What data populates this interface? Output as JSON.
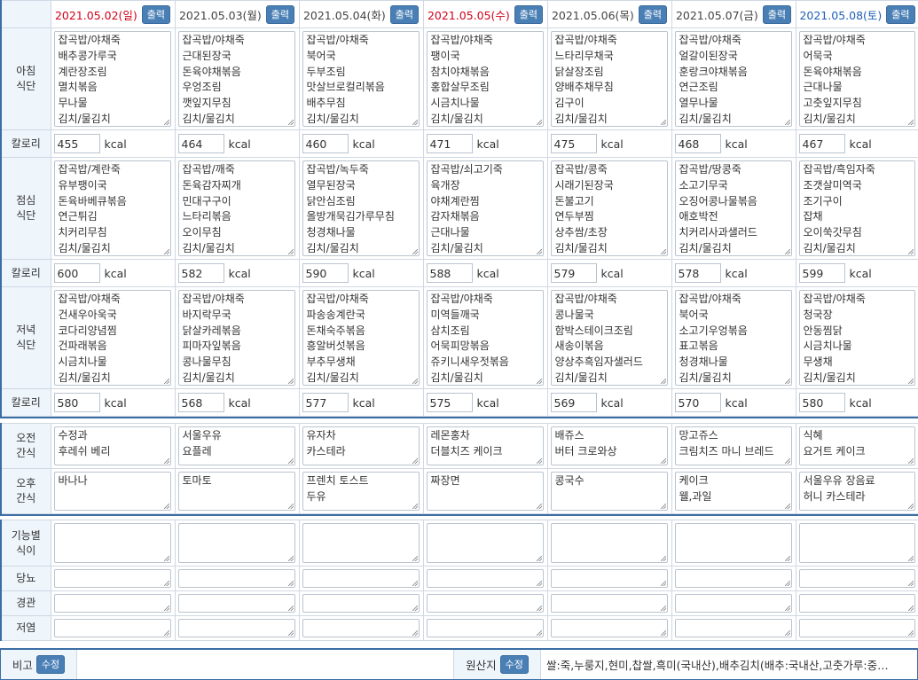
{
  "print_label": "출력",
  "edit_label": "수정",
  "unit": "kcal",
  "labels": {
    "breakfast": "아침\n식단",
    "lunch": "점심\n식단",
    "dinner": "저녁\n식단",
    "calorie": "칼로리",
    "am_snack": "오전\n간식",
    "pm_snack": "오후\n간식",
    "functional": "기능별\n식이",
    "diabetes": "당뇨",
    "tube": "경관",
    "low_salt": "저염"
  },
  "days": [
    {
      "date": "2021.05.02(일)",
      "type": "sun",
      "breakfast": "잡곡밥/야채죽\n배추콩가루국\n계란장조림\n멸치볶음\n무나물\n김치/물김치",
      "breakfast_kcal": "455",
      "lunch": "잡곡밥/계란죽\n유부팽이국\n돈육바베큐볶음\n연근튀김\n치커리무침\n김치/물김치",
      "lunch_kcal": "600",
      "dinner": "잡곡밥/야채죽\n건새우아욱국\n코다리양념찜\n건파래볶음\n시금치나물\n김치/물김치",
      "dinner_kcal": "580",
      "am": "수정과\n후레쉬 베리",
      "pm": "바나나"
    },
    {
      "date": "2021.05.03(월)",
      "type": "wk",
      "breakfast": "잡곡밥/야채죽\n근대된장국\n돈육야채볶음\n우엉조림\n깻잎지무침\n김치/물김치",
      "breakfast_kcal": "464",
      "lunch": "잡곡밥/깨죽\n돈육감자찌개\n민대구구이\n느타리볶음\n오이무침\n김치/물김치",
      "lunch_kcal": "582",
      "dinner": "잡곡밥/야채죽\n바지락무국\n닭살카레볶음\n피마자잎볶음\n콩나물무침\n김치/물김치",
      "dinner_kcal": "568",
      "am": "서울우유\n요플레",
      "pm": "토마토"
    },
    {
      "date": "2021.05.04(화)",
      "type": "wk",
      "breakfast": "잡곡밥/야채죽\n북어국\n두부조림\n맛살브로컬리볶음\n배추무침\n김치/물김치",
      "breakfast_kcal": "460",
      "lunch": "잡곡밥/녹두죽\n열무된장국\n닭안심조림\n올방개묵김가루무침\n청경채나물\n김치/물김치",
      "lunch_kcal": "590",
      "dinner": "잡곡밥/야채죽\n파송송계란국\n돈채숙주볶음\n흥알버섯볶음\n부추무생채\n김치/물김치",
      "dinner_kcal": "577",
      "am": "유자차\n카스테라",
      "pm": "프렌치 토스트\n두유"
    },
    {
      "date": "2021.05.05(수)",
      "type": "sun",
      "breakfast": "잡곡밥/야채죽\n팽이국\n참치야채볶음\n홍합살무조림\n시금치나물\n김치/물김치",
      "breakfast_kcal": "471",
      "lunch": "잡곡밥/쇠고기죽\n육개장\n야채계란찜\n감자채볶음\n근대나물\n김치/물김치",
      "lunch_kcal": "588",
      "dinner": "잡곡밥/야채죽\n미역들깨국\n삼치조림\n어묵피망볶음\n쥬키니새우젓볶음\n김치/물김치",
      "dinner_kcal": "575",
      "am": "레몬홍차\n더블치즈 케이크",
      "pm": "짜장면"
    },
    {
      "date": "2021.05.06(목)",
      "type": "wk",
      "breakfast": "잡곡밥/야채죽\n느타리무채국\n닭살장조림\n양배추채무침\n김구이\n김치/물김치",
      "breakfast_kcal": "475",
      "lunch": "잡곡밥/콩죽\n시래기된장국\n돈불고기\n연두부찜\n상추쌈/초장\n김치/물김치",
      "lunch_kcal": "579",
      "dinner": "잡곡밥/야채죽\n콩나물국\n함박스테이크조림\n새송이볶음\n양상추흑임자샐러드\n김치/물김치",
      "dinner_kcal": "569",
      "am": "배쥬스\n버터 크로와상",
      "pm": "콩국수"
    },
    {
      "date": "2021.05.07(금)",
      "type": "wk",
      "breakfast": "잡곡밥/야채죽\n얼갈이된장국\n훈랑크야채볶음\n연근조림\n열무나물\n김치/물김치",
      "breakfast_kcal": "468",
      "lunch": "잡곡밥/땅콩죽\n소고기무국\n오징어콩나물볶음\n애호박전\n치커리사과샐러드\n김치/물김치",
      "lunch_kcal": "578",
      "dinner": "잡곡밥/야채죽\n북어국\n소고기우엉볶음\n표고볶음\n청경채나물\n김치/물김치",
      "dinner_kcal": "570",
      "am": "망고쥬스\n크림치즈 마니 브레드",
      "pm": "케이크\n웰,과일"
    },
    {
      "date": "2021.05.08(토)",
      "type": "sat",
      "breakfast": "잡곡밥/야채죽\n어묵국\n돈육야채볶음\n근대나물\n고춧잎지무침\n김치/물김치",
      "breakfast_kcal": "467",
      "lunch": "잡곡밥/흑임자죽\n조갯살미역국\n조기구이\n잡채\n오이쑥갓무침\n김치/물김치",
      "lunch_kcal": "599",
      "dinner": "잡곡밥/야채죽\n청국장\n안동찜닭\n시금치나물\n무생채\n김치/물김치",
      "dinner_kcal": "580",
      "am": "식혜\n요거트 케이크",
      "pm": "서울우유 장음료\n허니 카스테라"
    }
  ],
  "bottom": {
    "memo_label": "비고",
    "origin_label": "원산지",
    "origin_value": "쌀:죽,누룽지,현미,찹쌀,흑미(국내산),배추김치(배추:국내산,고춧가루:중…"
  }
}
